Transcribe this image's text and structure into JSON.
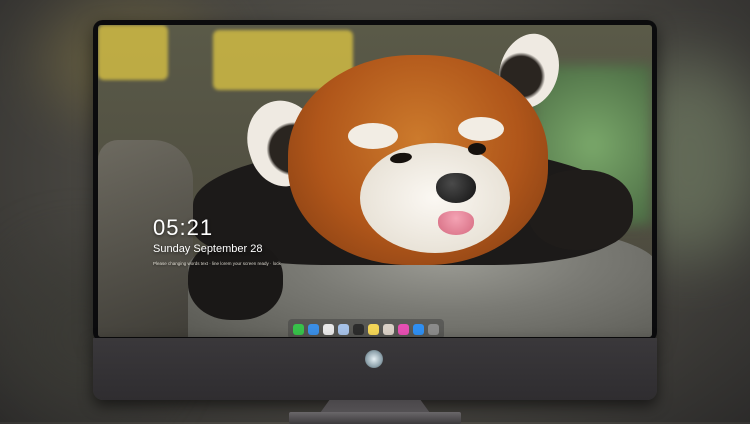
{
  "lockscreen": {
    "time": "05:21",
    "date": "Sunday September  28",
    "status_line": "Please changing words text · line lorem your screen ready · lock"
  },
  "dock": {
    "apps": [
      {
        "name": "messages-icon",
        "color": "#37c24a"
      },
      {
        "name": "finder-icon",
        "color": "#3a8ee6"
      },
      {
        "name": "safari-icon",
        "color": "#e8e8e8"
      },
      {
        "name": "preview-icon",
        "color": "#a6c2e8"
      },
      {
        "name": "clapper-icon",
        "color": "#2c2c2c"
      },
      {
        "name": "notes-icon",
        "color": "#f4d657"
      },
      {
        "name": "photos-icon",
        "color": "#d9d0c6"
      },
      {
        "name": "itunes-icon",
        "color": "#e64fb3"
      },
      {
        "name": "appstore-icon",
        "color": "#2f8ff2"
      },
      {
        "name": "trash-icon",
        "color": "#8b8b8b"
      }
    ]
  },
  "colors": {
    "bezel": "#0b0b0d",
    "chin": "#38363a",
    "text": "#ffffff"
  }
}
